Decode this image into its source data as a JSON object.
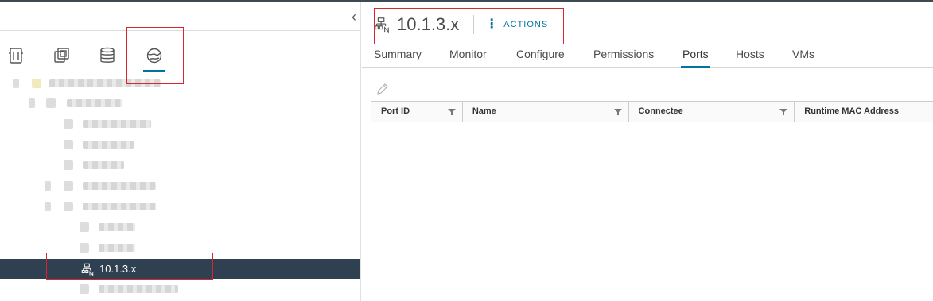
{
  "navigator": {
    "collapse_glyph": "‹",
    "icons": [
      {
        "name": "hosts-clusters-icon"
      },
      {
        "name": "vms-templates-icon"
      },
      {
        "name": "storage-icon"
      },
      {
        "name": "networking-icon",
        "active": true
      }
    ],
    "selected_item": {
      "label": "10.1.3.x",
      "icon": "distributed-port-group-icon"
    }
  },
  "object": {
    "title": "10.1.3.x",
    "icon": "distributed-port-group-icon",
    "actions_label": "ACTIONS"
  },
  "tabs": [
    {
      "label": "Summary"
    },
    {
      "label": "Monitor"
    },
    {
      "label": "Configure"
    },
    {
      "label": "Permissions"
    },
    {
      "label": "Ports",
      "active": true
    },
    {
      "label": "Hosts"
    },
    {
      "label": "VMs"
    }
  ],
  "grid": {
    "columns": [
      {
        "label": "Port ID"
      },
      {
        "label": "Name"
      },
      {
        "label": "Connectee"
      },
      {
        "label": "Runtime MAC Address"
      }
    ]
  },
  "colors": {
    "accent": "#0072a3",
    "selected_row": "#2f4050",
    "annotation": "#d9262c"
  }
}
